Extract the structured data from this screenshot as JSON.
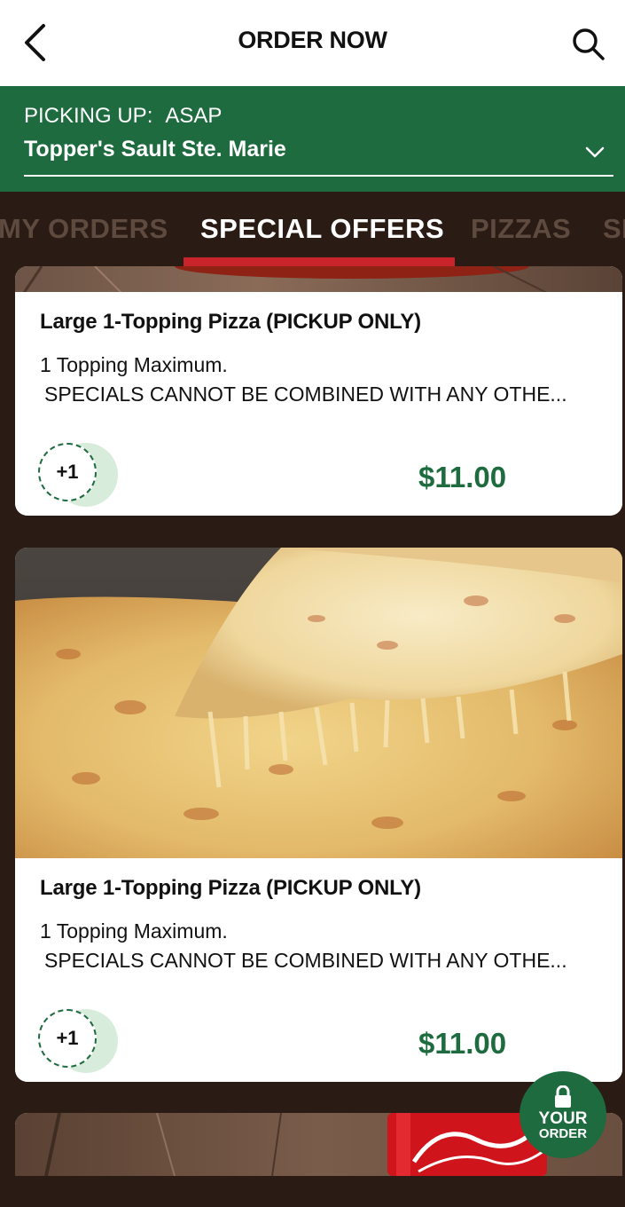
{
  "header": {
    "title": "ORDER NOW",
    "back_icon": "chevron-left-icon",
    "search_icon": "search-icon"
  },
  "pickup": {
    "label": "PICKING UP:",
    "time": "ASAP",
    "store": "Topper's Sault Ste. Marie",
    "chevron_icon": "chevron-down-icon"
  },
  "tabs": [
    {
      "label": "MY ORDERS",
      "active": false
    },
    {
      "label": "SPECIAL OFFERS",
      "active": true
    },
    {
      "label": "PIZZAS",
      "active": false
    },
    {
      "label": "SI",
      "active": false
    }
  ],
  "items": [
    {
      "title": "Large 1-Topping Pizza (PICKUP ONLY)",
      "desc_line1": "1 Topping Maximum.",
      "desc_line2": "SPECIALS CANNOT BE COMBINED WITH ANY OTHE...",
      "add_label": "+1",
      "price": "$11.00"
    },
    {
      "title": "Large 1-Topping Pizza (PICKUP ONLY)",
      "desc_line1": "1 Topping Maximum.",
      "desc_line2": "SPECIALS CANNOT BE COMBINED WITH ANY OTHE...",
      "add_label": "+1",
      "price": "$11.00"
    }
  ],
  "order_button": {
    "line1": "YOUR",
    "line2": "ORDER",
    "icon": "lock-icon"
  },
  "colors": {
    "brand_green": "#1d6b3f",
    "background_brown": "#2a1c14",
    "tab_indicator_red": "#c9232b"
  }
}
